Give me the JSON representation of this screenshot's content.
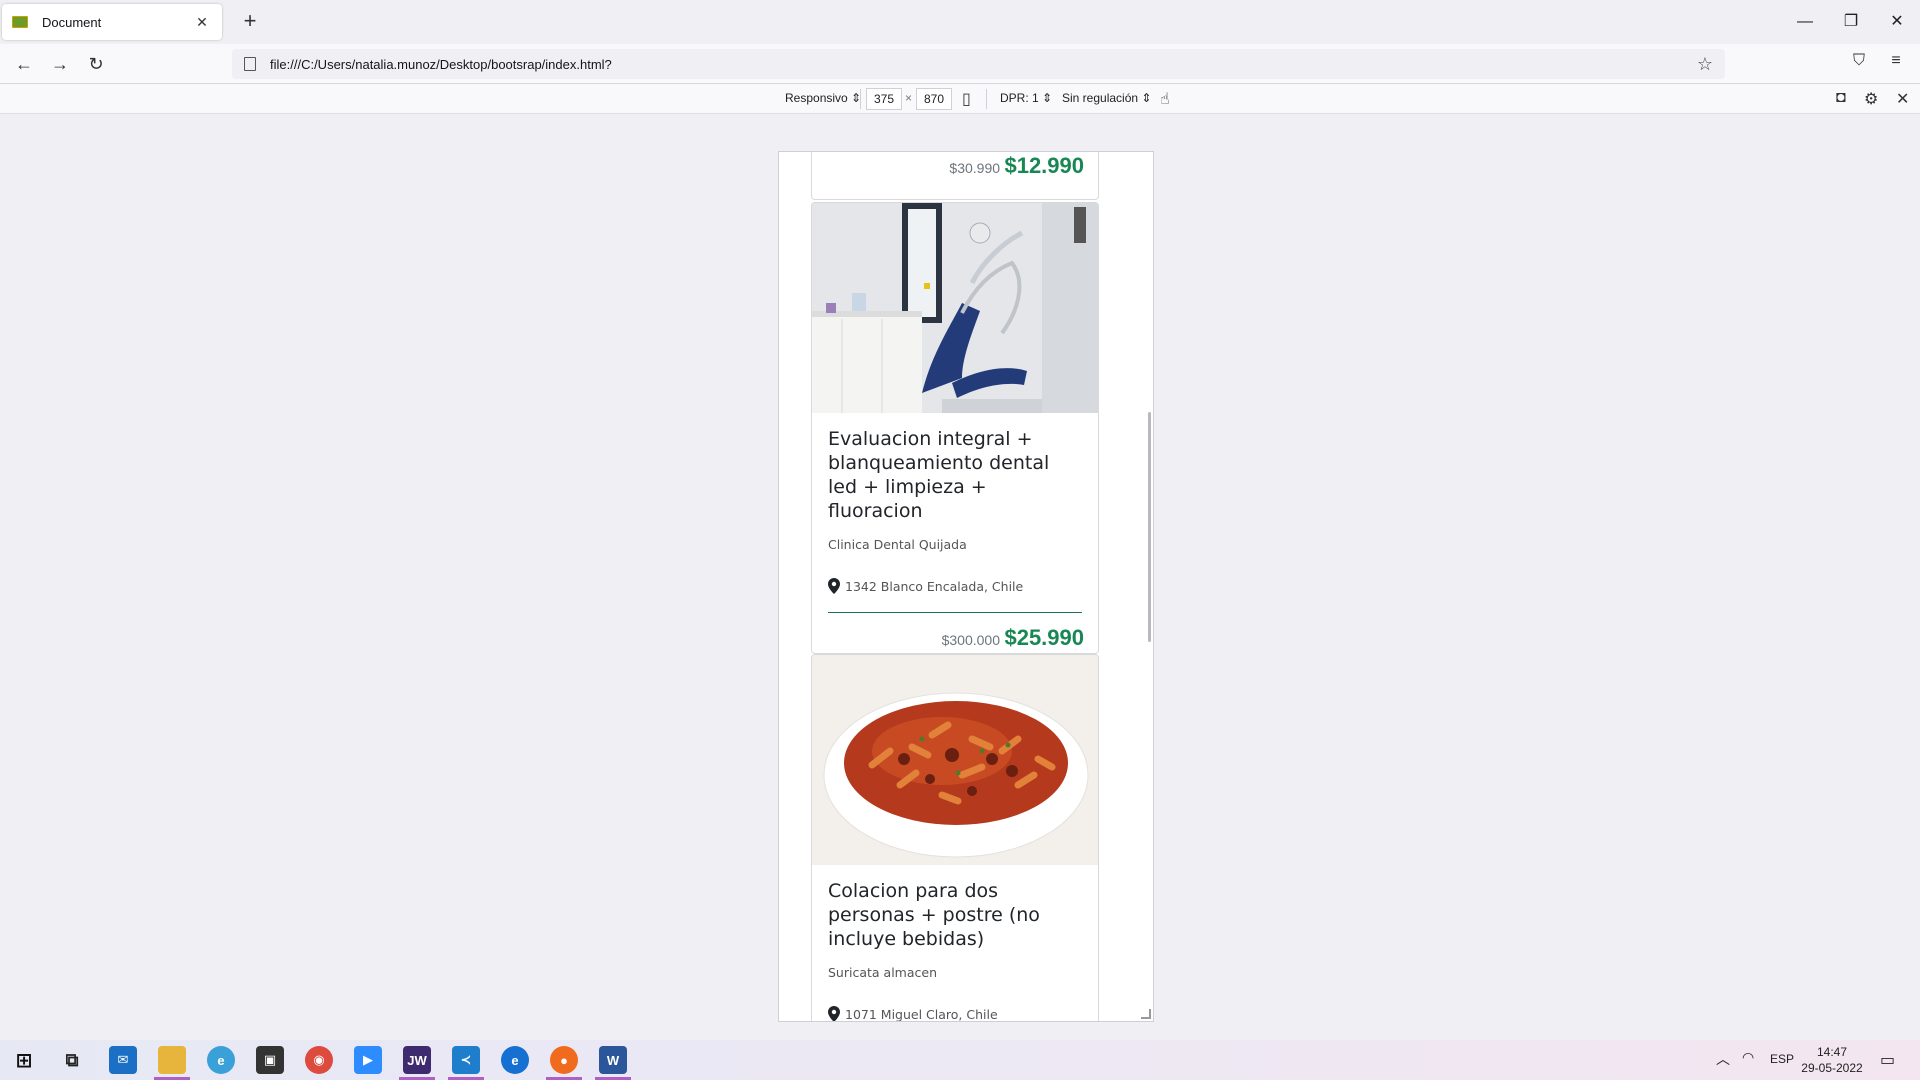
{
  "browser": {
    "tab_title": "Document",
    "url": "file:///C:/Users/natalia.munoz/Desktop/bootsrap/index.html?"
  },
  "responsive_toolbar": {
    "device": "Responsivo",
    "width": "375",
    "times": "×",
    "height": "870",
    "dpr": "DPR: 1",
    "throttling": "Sin regulación"
  },
  "cards": [
    {
      "old_price": "$30.990",
      "new_price": "$12.990"
    },
    {
      "title": "Evaluacion integral + blanqueamiento dental led + limpieza + fluoracion",
      "business": "Clinica Dental Quijada",
      "location": "1342 Blanco Encalada, Chile",
      "old_price": "$300.000",
      "new_price": "$25.990",
      "image": "dental-clinic-photo"
    },
    {
      "title": "Colacion para dos personas + postre (no incluye bebidas)",
      "business": "Suricata almacen",
      "location": "1071 Miguel Claro, Chile",
      "image": "pasta-bowl-photo"
    }
  ],
  "taskbar": {
    "jw_label": "JW",
    "edge_label": "e",
    "word_label": "W",
    "lang": "ESP",
    "time": "14:47",
    "date": "29-05-2022"
  },
  "colors": {
    "price_green": "#198754",
    "divider_green": "#1e6e50"
  }
}
